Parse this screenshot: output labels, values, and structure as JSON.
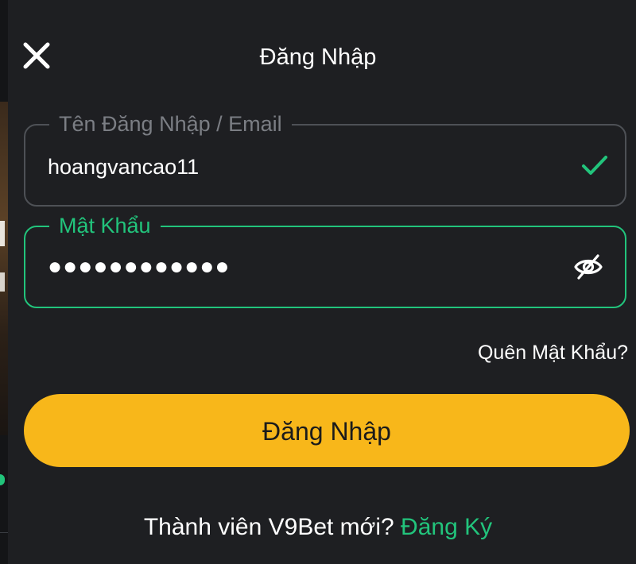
{
  "header": {
    "title": "Đăng Nhập",
    "close_icon": "close-icon"
  },
  "username_field": {
    "label": "Tên Đăng Nhập / Email",
    "value": "hoangvancao11",
    "status_icon": "check-icon"
  },
  "password_field": {
    "label": "Mật Khẩu",
    "value": "●●●●●●●●●●●●",
    "toggle_icon": "eye-off-icon"
  },
  "forgot_password": "Quên Mật Khẩu?",
  "login_button": "Đăng Nhập",
  "footer": {
    "prompt": "Thành viên V9Bet mới?",
    "register_link": "Đăng Ký"
  },
  "colors": {
    "background": "#1e1f22",
    "accent_green": "#22c47c",
    "button_yellow": "#f8b71a",
    "border_gray": "#4e5156",
    "label_gray": "#7b7e84"
  }
}
